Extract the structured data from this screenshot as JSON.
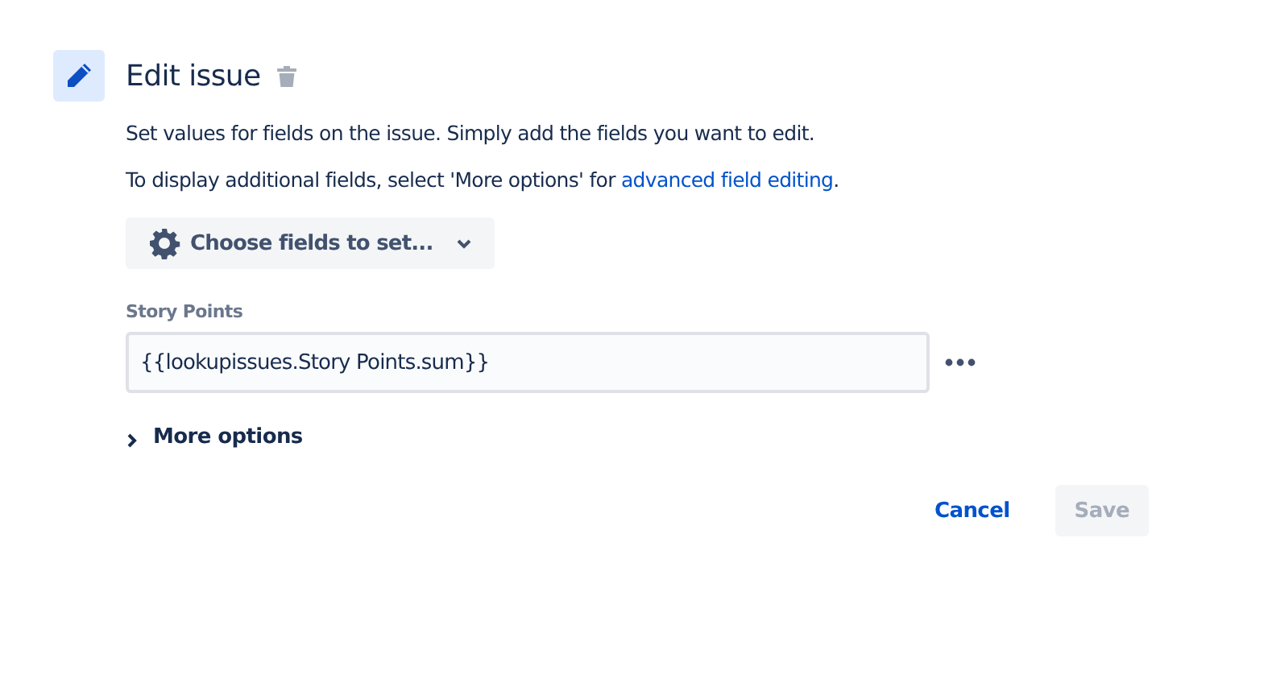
{
  "header": {
    "title": "Edit issue"
  },
  "description": "Set values for fields on the issue. Simply add the fields you want to edit.",
  "hint": {
    "before": "To display additional fields, select 'More options' for ",
    "link": "advanced field editing",
    "after": "."
  },
  "choose_button": {
    "label": "Choose fields to set..."
  },
  "fields": [
    {
      "label": "Story Points",
      "value": "{{lookupissues.Story Points.sum}}"
    }
  ],
  "more_options": {
    "label": "More options",
    "expanded": false
  },
  "actions": [
    {
      "label": "Cancel",
      "kind": "link",
      "disabled": false
    },
    {
      "label": "Save",
      "kind": "button",
      "disabled": true
    }
  ]
}
